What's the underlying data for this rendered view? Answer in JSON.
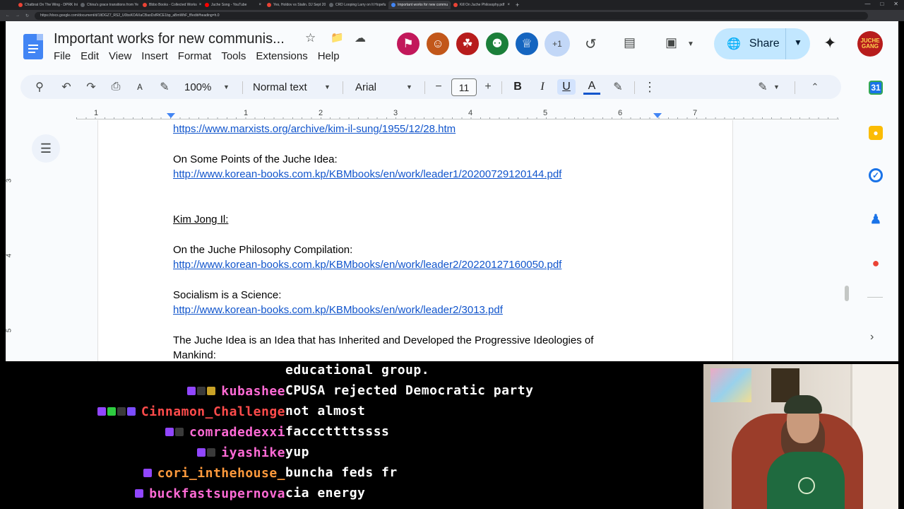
{
  "browser": {
    "tabs": [
      {
        "title": "Chatbrat On The Wing - DPRK Ini",
        "color": "#ea4335"
      },
      {
        "title": "China's grace transitions from Ye",
        "color": "#5f6368"
      },
      {
        "title": "Bbbo Books - Collected Works",
        "color": "#ea4335"
      },
      {
        "title": "Juche Song - YouTube",
        "color": "#ff0000"
      },
      {
        "title": "Yes, Holdov vs Stalin. DJ Sept 20",
        "color": "#ea4335"
      },
      {
        "title": "CRD Looping Larry on It Hopefu",
        "color": "#5f6368"
      },
      {
        "title": "Important works for new commu",
        "color": "#4285f4",
        "active": true
      },
      {
        "title": "Kill On Juche Philosophy.pdf",
        "color": "#ea4335"
      }
    ],
    "url": "https://docs.google.com/document/d/1ItDGZ7_RS2_U0bsKOAXaCBaoDsfRtCE1bp_aBmWhF_ff/edit#heading=h.0"
  },
  "docs": {
    "title": "Important works for new communis...",
    "menu": [
      "File",
      "Edit",
      "View",
      "Insert",
      "Format",
      "Tools",
      "Extensions",
      "Help"
    ],
    "collaborators": [
      {
        "icon": "⚑",
        "color": "#c2185b"
      },
      {
        "icon": "☺",
        "color": "#c2571a"
      },
      {
        "icon": "☘",
        "color": "#b71c1c"
      },
      {
        "icon": "⚉",
        "color": "#1b7f3a"
      },
      {
        "icon": "♕",
        "color": "#1565c0"
      }
    ],
    "collab_more": "+1",
    "share_label": "Share",
    "avatar_text": "JUCHE GANG",
    "toolbar": {
      "zoom": "100%",
      "style": "Normal text",
      "font": "Arial",
      "font_size": "11",
      "minus": "−",
      "plus": "+",
      "bold": "B",
      "italic": "I",
      "underline": "U",
      "text_color": "A"
    },
    "ruler_numbers": [
      "1",
      "1",
      "2",
      "3",
      "4",
      "5",
      "6",
      "7"
    ],
    "vruler_numbers": [
      "3",
      "4",
      "5"
    ],
    "content": {
      "link_kim_il_sung": "https://www.marxists.org/archive/kim-il-sung/1955/12/28.htm",
      "title_points": "On Some Points of the Juche Idea:",
      "link_points": "http://www.korean-books.com.kp/KBMbooks/en/work/leader1/20200729120144.pdf",
      "heading_kim_jong_il": "Kim Jong Il:",
      "title_compilation": "On the Juche Philosophy Compilation:",
      "link_compilation": "http://www.korean-books.com.kp/KBMbooks/en/work/leader2/20220127160050.pdf",
      "title_science": "Socialism is a Science:",
      "link_science": "http://www.korean-books.com.kp/KBMbooks/en/work/leader2/3013.pdf",
      "title_inherited_1": "The Juche Idea is an Idea that has Inherited and Developed the Progressive Ideologies of",
      "title_inherited_2": "Mankind:"
    }
  },
  "chat": {
    "messages": [
      {
        "user": "",
        "text": "educational group.",
        "color": "#ffffff",
        "badges": []
      },
      {
        "user": "kubashee",
        "text": "CPUSA rejected Democratic party",
        "color": "#ff6ad5",
        "badges": [
          "#9146ff",
          "#3a3a3a",
          "#c9a227"
        ]
      },
      {
        "user": "Cinnamon_Challenge",
        "text": "not almost",
        "color": "#ff4b4b",
        "badges": [
          "#9146ff",
          "#2ecc40",
          "#3a3a3a",
          "#7b4cff"
        ]
      },
      {
        "user": "comradedexxi",
        "text": "facccttttssss",
        "color": "#ff6ad5",
        "badges": [
          "#9146ff",
          "#3a3a3a"
        ]
      },
      {
        "user": "iyashike",
        "text": "yup",
        "color": "#ff6ad5",
        "badges": [
          "#9146ff",
          "#3a3a3a"
        ]
      },
      {
        "user": "cori_inthehouse_",
        "text": "buncha feds fr",
        "color": "#ff9a3c",
        "badges": [
          "#9146ff"
        ]
      },
      {
        "user": "buckfastsupernova",
        "text": "cia energy",
        "color": "#ff6ad5",
        "badges": [
          "#9146ff"
        ]
      }
    ]
  },
  "colors": {
    "link": "#1155cc",
    "share_bg": "#c2e7ff",
    "toolbar_bg": "#edf2fa"
  }
}
